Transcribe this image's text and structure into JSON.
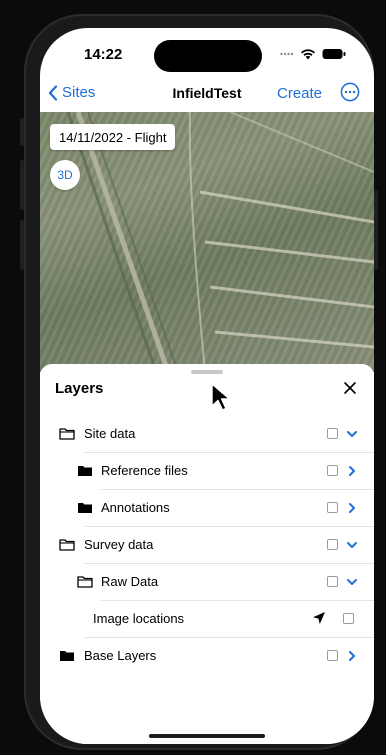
{
  "status_bar": {
    "time": "14:22",
    "signal_icon": "signal-dots-icon",
    "wifi_icon": "wifi-icon",
    "battery_icon": "battery-icon"
  },
  "nav": {
    "back_label": "Sites",
    "title": "InfieldTest",
    "create_label": "Create",
    "more_icon": "ellipsis-circle-icon"
  },
  "map": {
    "flight_label": "14/11/2022 - Flight",
    "three_d_label": "3D"
  },
  "layers": {
    "title": "Layers",
    "close_icon": "close-icon",
    "rows": [
      {
        "label": "Site data",
        "folder": "outline",
        "checked": false,
        "expanded": true
      },
      {
        "label": "Reference files",
        "folder": "filled",
        "checked": false,
        "expanded": false
      },
      {
        "label": "Annotations",
        "folder": "filled",
        "checked": false,
        "expanded": false
      },
      {
        "label": "Survey data",
        "folder": "outline",
        "checked": false,
        "expanded": true
      },
      {
        "label": "Raw Data",
        "folder": "outline",
        "checked": false,
        "expanded": true
      },
      {
        "label": "Image locations",
        "folder": "none",
        "checked": false,
        "location_icon": "location-arrow-icon"
      },
      {
        "label": "Base Layers",
        "folder": "filled",
        "checked": false,
        "expanded": false
      }
    ]
  },
  "colors": {
    "accent": "#1f6fd6",
    "divider": "#e4e4e7"
  }
}
